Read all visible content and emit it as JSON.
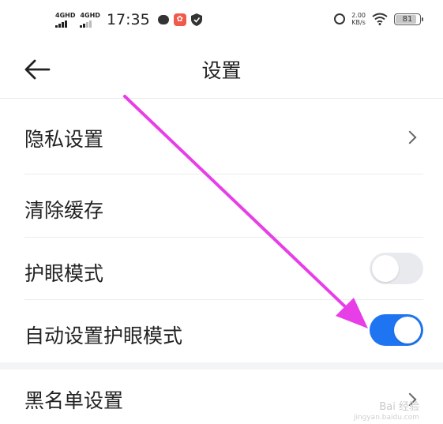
{
  "status_bar": {
    "signal_1": "4GHD",
    "signal_2": "4GHD",
    "time": "17:35",
    "net_speed_value": "2.00",
    "net_speed_unit": "KB/s",
    "battery": "81",
    "battery_level": 0.81
  },
  "header": {
    "title": "设置"
  },
  "settings": {
    "items": [
      {
        "label": "隐私设置",
        "type": "link"
      },
      {
        "label": "清除缓存",
        "type": "action"
      },
      {
        "label": "护眼模式",
        "type": "toggle",
        "on": false
      },
      {
        "label": "自动设置护眼模式",
        "type": "toggle",
        "on": true
      },
      {
        "label": "黑名单设置",
        "type": "link"
      }
    ]
  },
  "colors": {
    "accent": "#1f74f2",
    "annotation_arrow": "#e83ee8"
  },
  "watermark": {
    "text": "Bai 经验",
    "sub": "jingyan.baidu.com"
  }
}
